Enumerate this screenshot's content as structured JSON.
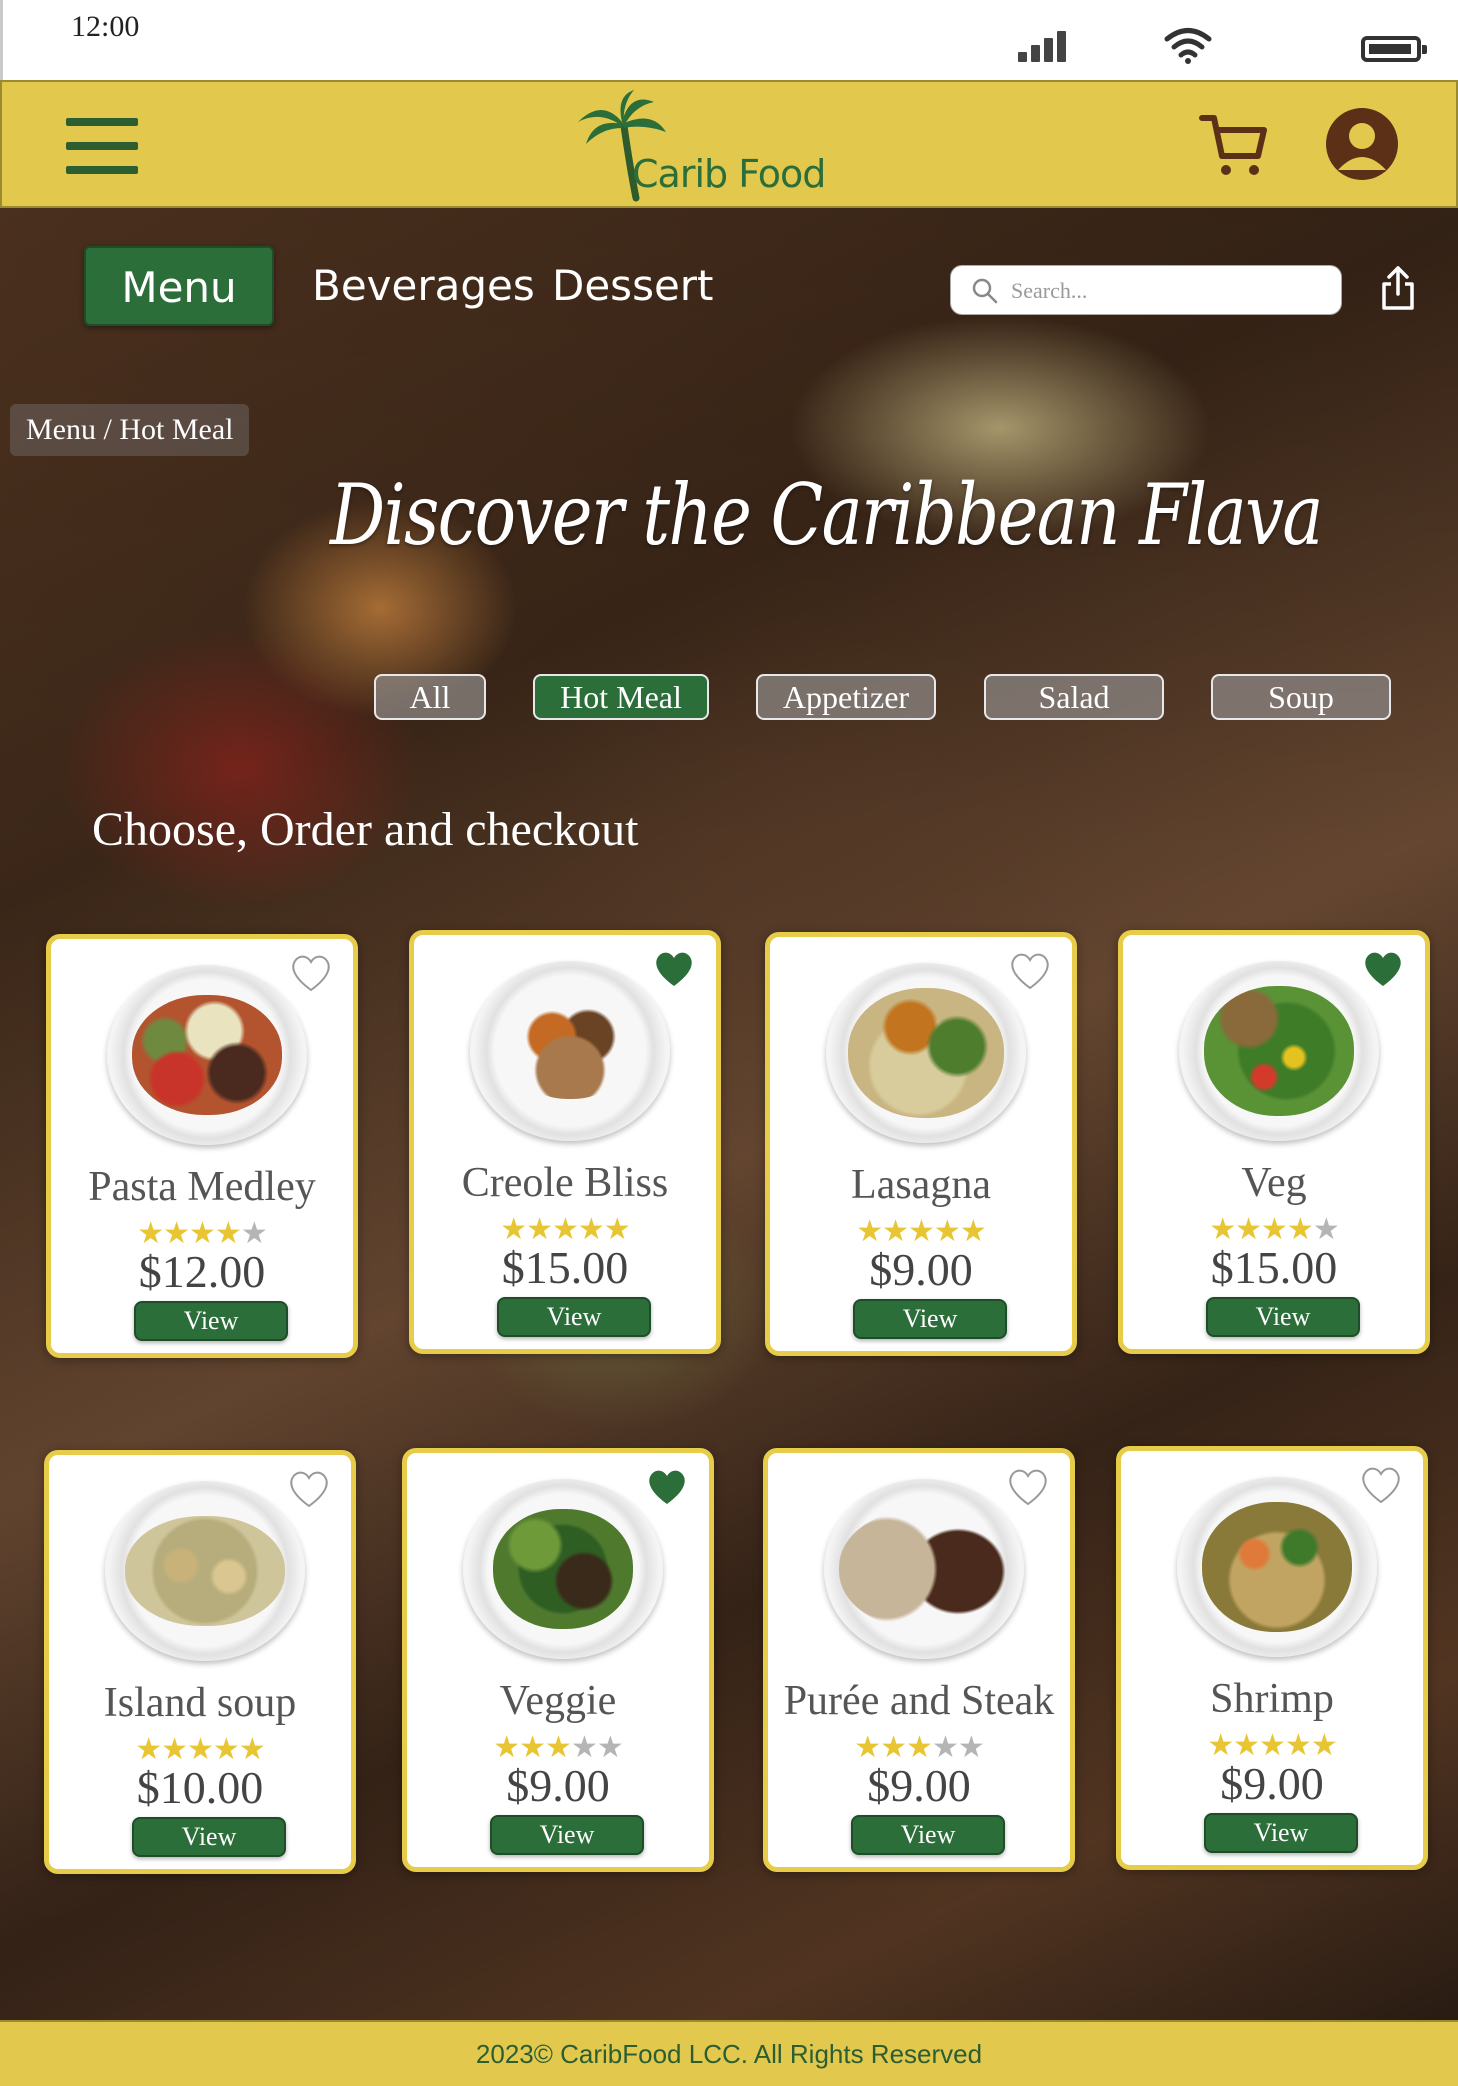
{
  "status_bar": {
    "time": "12:00"
  },
  "header": {
    "logo_text": "Carib Food"
  },
  "nav": {
    "tabs": [
      {
        "label": "Menu",
        "active": true
      },
      {
        "label": "Beverages",
        "active": false
      },
      {
        "label": "Dessert",
        "active": false
      }
    ],
    "search_placeholder": "Search..."
  },
  "breadcrumb": "Menu / Hot Meal",
  "hero_title": "Discover the Caribbean Flava",
  "filters": [
    {
      "label": "All",
      "active": false
    },
    {
      "label": "Hot Meal",
      "active": true
    },
    {
      "label": "Appetizer",
      "active": false
    },
    {
      "label": "Salad",
      "active": false
    },
    {
      "label": "Soup",
      "active": false
    }
  ],
  "subtitle": "Choose, Order and checkout",
  "products": [
    {
      "name": "Pasta Medley",
      "rating": 4,
      "price": "$12.00",
      "favorite": false,
      "button": "View"
    },
    {
      "name": "Creole Bliss",
      "rating": 5,
      "price": "$15.00",
      "favorite": true,
      "button": "View"
    },
    {
      "name": "Lasagna",
      "rating": 5,
      "price": "$9.00",
      "favorite": false,
      "button": "View"
    },
    {
      "name": "Veg",
      "rating": 4,
      "price": "$15.00",
      "favorite": true,
      "button": "View"
    },
    {
      "name": "Island soup",
      "rating": 5,
      "price": "$10.00",
      "favorite": false,
      "button": "View"
    },
    {
      "name": "Veggie",
      "rating": 3,
      "price": "$9.00",
      "favorite": true,
      "button": "View"
    },
    {
      "name": "Purée and Steak",
      "rating": 3,
      "price": "$9.00",
      "favorite": false,
      "button": "View"
    },
    {
      "name": "Shrimp",
      "rating": 5,
      "price": "$9.00",
      "favorite": false,
      "button": "View"
    }
  ],
  "footer": "2023©  CaribFood LCC. All Rights Reserved",
  "colors": {
    "brand_yellow": "#e2c94e",
    "brand_green": "#2c6e3a",
    "star_gold": "#e8c532",
    "avatar_brown": "#5c3016"
  }
}
